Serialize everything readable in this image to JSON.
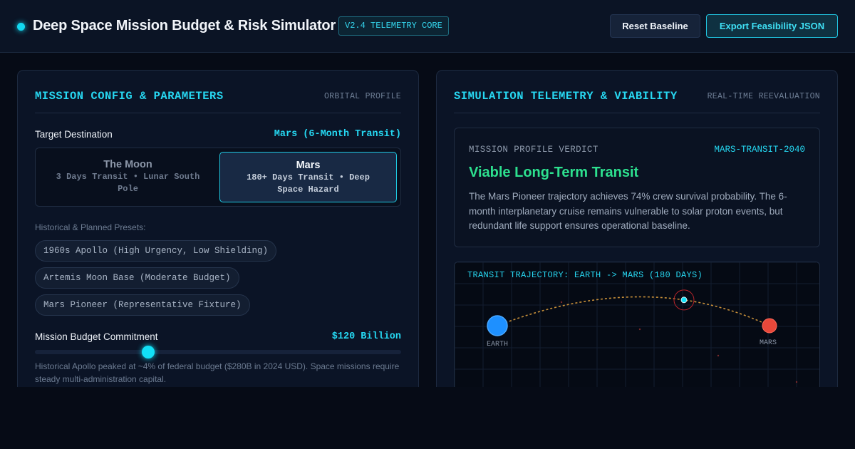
{
  "header": {
    "title": "Deep Space Mission Budget & Risk Simulator",
    "version_badge": "V2.4 TELEMETRY CORE",
    "reset_label": "Reset Baseline",
    "export_label": "Export Feasibility JSON"
  },
  "left_panel": {
    "title": "MISSION CONFIG & PARAMETERS",
    "subtitle": "ORBITAL PROFILE",
    "destination": {
      "label": "Target Destination",
      "value": "Mars (6-Month Transit)",
      "options": [
        {
          "name": "The Moon",
          "desc": "3 Days Transit • Lunar South Pole",
          "selected": false
        },
        {
          "name": "Mars",
          "desc": "180+ Days Transit • Deep Space Hazard",
          "selected": true
        }
      ]
    },
    "presets": {
      "label": "Historical & Planned Presets:",
      "items": [
        "1960s Apollo (High Urgency, Low Shielding)",
        "Artemis Moon Base (Moderate Budget)",
        "Mars Pioneer (Representative Fixture)"
      ]
    },
    "budget": {
      "label": "Mission Budget Commitment",
      "value": "$120 Billion",
      "slider_fraction": 0.31,
      "note": "Historical Apollo peaked at ~4% of federal budget ($280B in 2024 USD). Space missions require steady multi-administration capital."
    }
  },
  "right_panel": {
    "title": "SIMULATION TELEMETRY & VIABILITY",
    "subtitle": "REAL-TIME REEVALUATION",
    "verdict": {
      "label": "MISSION PROFILE VERDICT",
      "code": "MARS-TRANSIT-2040",
      "title": "Viable Long-Term Transit",
      "text": "The Mars Pioneer trajectory achieves 74% crew survival probability. The 6-month interplanetary cruise remains vulnerable to solar proton events, but redundant life support ensures operational baseline."
    },
    "trajectory": {
      "title": "TRANSIT TRAJECTORY: EARTH -> MARS (180 DAYS)",
      "origin_label": "EARTH",
      "destination_label": "MARS",
      "progress_fraction": 0.68
    }
  },
  "colors": {
    "accent": "#12d8f0",
    "viable": "#2de08f",
    "earth": "#1e90ff",
    "mars": "#e8483a",
    "path": "#c8903a"
  },
  "icons": {
    "status": "status-dot-icon",
    "spacecraft": "spacecraft-marker-icon"
  }
}
